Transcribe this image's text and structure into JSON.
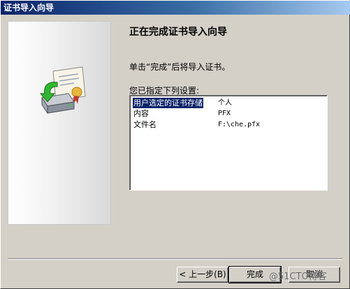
{
  "window": {
    "title": "证书导入向导"
  },
  "wizard": {
    "heading": "正在完成证书导入向导",
    "instruction": "单击“完成”后将导入证书。",
    "settings_label": "您已指定下列设置:",
    "settings": [
      {
        "key": "用户选定的证书存储",
        "value": "个人"
      },
      {
        "key": "内容",
        "value": "PFX"
      },
      {
        "key": "文件名",
        "value": "F:\\che.pfx"
      }
    ],
    "illustration_icon": "certificate-import-icon"
  },
  "buttons": {
    "back": "< 上一步(B)",
    "finish": "完成",
    "cancel": "取消"
  },
  "watermark": "@51CTO博客"
}
